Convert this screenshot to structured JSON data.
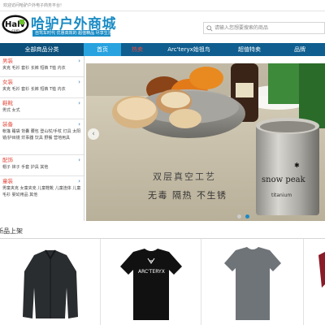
{
  "topbar": {
    "welcome": "欢迎访问哈驴户外电子商务平台!"
  },
  "header": {
    "logo_badge": "Halv",
    "logo_badge_sub": ".com",
    "logo_title": "哈驴户外商城",
    "logo_slogan": "自驾车时代 优惠高效的 超值精品 尽享生活",
    "search_placeholder": "请输入您想要搜索的商品"
  },
  "nav": {
    "all_label": "全部商品分类",
    "items": [
      {
        "label": "首页",
        "active": true
      },
      {
        "label": "热卖"
      },
      {
        "label": "Arc'teryx始祖鸟"
      },
      {
        "label": "超值特卖"
      },
      {
        "label": "品牌"
      }
    ]
  },
  "sidebar": {
    "categories": [
      {
        "title": "男装",
        "links": "夹克 毛衫 套衫 长裤 短裤 T恤 内衣"
      },
      {
        "title": "女装",
        "links": "夹克 毛衫 套衫 长裤 短裤 T恤 内衣"
      },
      {
        "title": "鞋靴",
        "links": "男式 女式"
      },
      {
        "title": "装备",
        "links": "帐篷 睡袋 背囊 腰包 登山杖/手杖 灯具 太阳镜/护目镜 炊事器 饮具 野餐 营地用具"
      },
      {
        "title": "配饰",
        "links": "帽子 袜子 手套 护具 其他"
      },
      {
        "title": "童装",
        "links": "男童夹克 女童夹克 儿童鞋靴 儿童连体 儿童毛衫 婴幼用品 其他"
      }
    ]
  },
  "banner": {
    "caption1": "双层真空工艺",
    "caption2": "无毒 隔热 不生锈",
    "cup_brand": "snow peak",
    "cup_material": "titanium",
    "slides": 2,
    "active_slide": 2
  },
  "products_section": {
    "title": "新品上架",
    "items": [
      {
        "name": "black-softshell-jacket",
        "color": "#2a2d30"
      },
      {
        "name": "arcteryx-black-tshirt",
        "logo": "ARC'TERYX",
        "color": "#111111"
      },
      {
        "name": "grey-tshirt",
        "color": "#6f7479"
      },
      {
        "name": "red-item-partial",
        "color": "#8a1b28"
      }
    ]
  }
}
